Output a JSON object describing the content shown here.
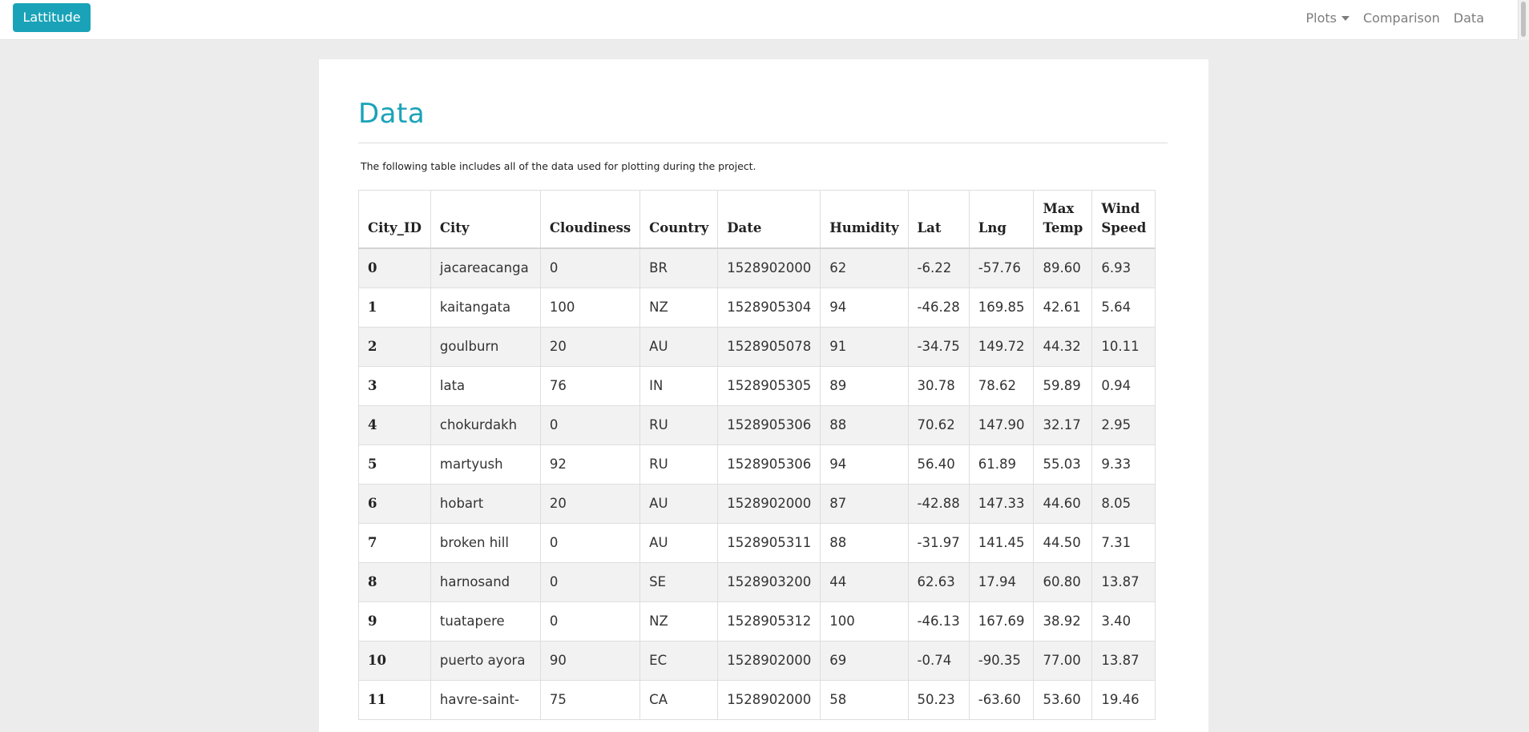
{
  "navbar": {
    "brand": "Lattitude",
    "links": [
      {
        "label": "Plots",
        "dropdown": true
      },
      {
        "label": "Comparison"
      },
      {
        "label": "Data"
      }
    ]
  },
  "page": {
    "title": "Data",
    "description": "The following table includes all of the data used for plotting during the project."
  },
  "table": {
    "headers": [
      "City_ID",
      "City",
      "Cloudiness",
      "Country",
      "Date",
      "Humidity",
      "Lat",
      "Lng",
      "Max Temp",
      "Wind Speed"
    ],
    "rows": [
      [
        "0",
        "jacareacanga",
        "0",
        "BR",
        "1528902000",
        "62",
        "-6.22",
        "-57.76",
        "89.60",
        "6.93"
      ],
      [
        "1",
        "kaitangata",
        "100",
        "NZ",
        "1528905304",
        "94",
        "-46.28",
        "169.85",
        "42.61",
        "5.64"
      ],
      [
        "2",
        "goulburn",
        "20",
        "AU",
        "1528905078",
        "91",
        "-34.75",
        "149.72",
        "44.32",
        "10.11"
      ],
      [
        "3",
        "lata",
        "76",
        "IN",
        "1528905305",
        "89",
        "30.78",
        "78.62",
        "59.89",
        "0.94"
      ],
      [
        "4",
        "chokurdakh",
        "0",
        "RU",
        "1528905306",
        "88",
        "70.62",
        "147.90",
        "32.17",
        "2.95"
      ],
      [
        "5",
        "martyush",
        "92",
        "RU",
        "1528905306",
        "94",
        "56.40",
        "61.89",
        "55.03",
        "9.33"
      ],
      [
        "6",
        "hobart",
        "20",
        "AU",
        "1528902000",
        "87",
        "-42.88",
        "147.33",
        "44.60",
        "8.05"
      ],
      [
        "7",
        "broken hill",
        "0",
        "AU",
        "1528905311",
        "88",
        "-31.97",
        "141.45",
        "44.50",
        "7.31"
      ],
      [
        "8",
        "harnosand",
        "0",
        "SE",
        "1528903200",
        "44",
        "62.63",
        "17.94",
        "60.80",
        "13.87"
      ],
      [
        "9",
        "tuatapere",
        "0",
        "NZ",
        "1528905312",
        "100",
        "-46.13",
        "167.69",
        "38.92",
        "3.40"
      ],
      [
        "10",
        "puerto ayora",
        "90",
        "EC",
        "1528902000",
        "69",
        "-0.74",
        "-90.35",
        "77.00",
        "13.87"
      ],
      [
        "11",
        "havre-saint-",
        "75",
        "CA",
        "1528902000",
        "58",
        "50.23",
        "-63.60",
        "53.60",
        "19.46"
      ]
    ]
  },
  "colors": {
    "accent": "#1aa3b8",
    "background": "#ececec"
  }
}
